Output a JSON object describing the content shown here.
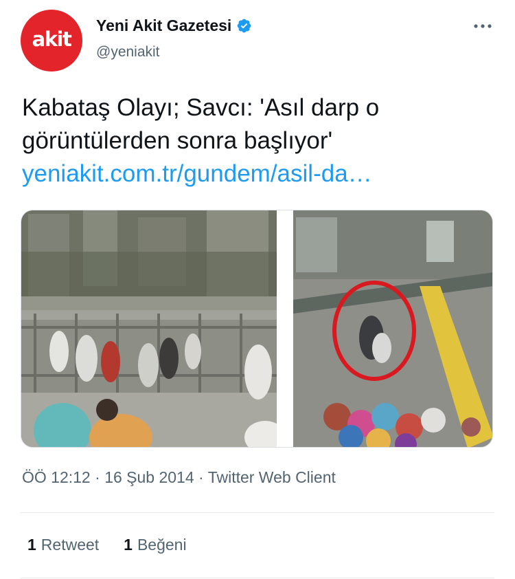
{
  "account": {
    "avatar_text": "akit",
    "display_name": "Yeni Akit Gazetesi",
    "handle": "@yeniakit",
    "verified": true
  },
  "tweet": {
    "text_line1": "Kabataş Olayı; Savcı: 'Asıl darp o",
    "text_line2": "görüntülerden sonra başlıyor'",
    "link": "yeniakit.com.tr/gundem/asil-da…"
  },
  "meta": {
    "time": "ÖÖ 12:12",
    "date": "16 Şub 2014",
    "client": "Twitter Web Client",
    "separator": "·"
  },
  "stats": {
    "retweets_count": "1",
    "retweets_label": "Retweet",
    "likes_count": "1",
    "likes_label": "Beğeni"
  },
  "colors": {
    "brand_red": "#e3242b",
    "link_blue": "#1d9bf0",
    "verified_blue": "#1d9bf0",
    "secondary_text": "#536471"
  },
  "icons": {
    "verified": "verified-badge-icon",
    "more": "more-options-icon"
  }
}
